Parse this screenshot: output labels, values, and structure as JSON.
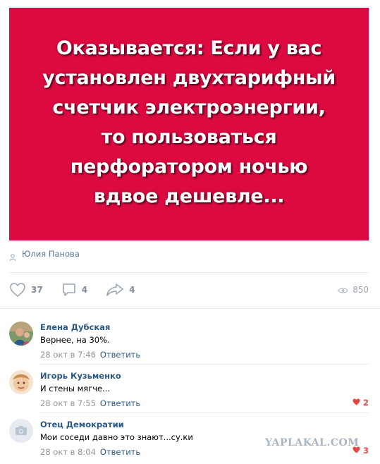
{
  "post": {
    "image_text_lines": [
      "Оказывается: Если у вас",
      "установлен двухтарифный",
      "счетчик электроэнергии,",
      "то пользоваться",
      "перфоратором ночью",
      "вдвое дешевле..."
    ],
    "banner_color": "#dc0a40",
    "author": "Юлия Панова",
    "likes": "37",
    "comments": "4",
    "shares": "4",
    "views": "850"
  },
  "comments": [
    {
      "name": "Елена Дубская",
      "text": "Вернее, на 30%.",
      "date": "28 окт в 7:46",
      "reply": "Ответить",
      "likes": ""
    },
    {
      "name": "Игорь Кузьменко",
      "text": "И стены мягче...",
      "date": "28 окт в 7:55",
      "reply": "Ответить",
      "likes": "2"
    },
    {
      "name": "Отец Демократии",
      "text": "Мои соседи давно это знают...су.ки",
      "date": "28 окт в 8:04",
      "reply": "Ответить",
      "likes": "3"
    }
  ],
  "watermark": "YAPLAKAL.COM",
  "colors": {
    "link": "#2a5885",
    "like_red": "#e64646",
    "muted": "#939393"
  },
  "icons": [
    "person-icon",
    "heart-icon",
    "comment-icon",
    "share-icon",
    "eye-icon",
    "camera-icon"
  ]
}
